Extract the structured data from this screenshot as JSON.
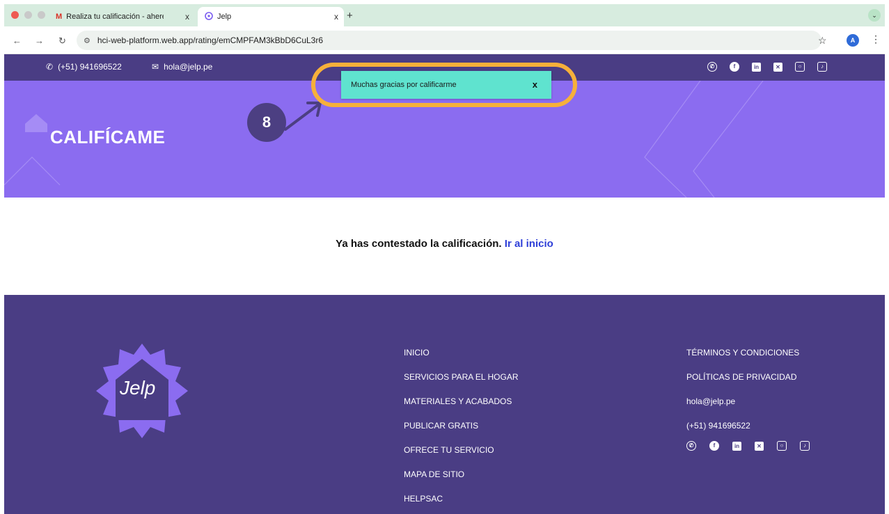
{
  "browser": {
    "tabs": [
      {
        "title": "Realiza tu calificación - ahere",
        "icon": "gmail-icon",
        "close": "x"
      },
      {
        "title": "Jelp",
        "icon": "jelp-favicon-icon",
        "close": "x"
      }
    ],
    "new_tab": "+",
    "menu": "⌄",
    "url": "hci-web-platform.web.app/rating/emCMPFAM3kBbD6CuL3r6",
    "profile_initial": "A"
  },
  "topbar": {
    "phone": "(+51) 941696522",
    "email": "hola@jelp.pe",
    "socials": [
      "whatsapp-icon",
      "facebook-icon",
      "linkedin-icon",
      "x-icon",
      "instagram-icon",
      "tiktok-icon"
    ]
  },
  "hero": {
    "title": "CALIFÍCAME"
  },
  "toast": {
    "message": "Muchas gracias por calificarme",
    "close": "x"
  },
  "annotation": {
    "step": "8",
    "highlight_color": "#f6b03a"
  },
  "main": {
    "message": "Ya has contestado la calificación.",
    "link": "Ir al inicio"
  },
  "footer": {
    "logo_text": "Jelp",
    "col1": [
      "INICIO",
      "SERVICIOS PARA EL HOGAR",
      "MATERIALES Y ACABADOS",
      "PUBLICAR GRATIS",
      "OFRECE TU SERVICIO",
      "MAPA DE SITIO",
      "HELPSAC"
    ],
    "col2": [
      "TÉRMINOS Y CONDICIONES",
      "POLÍTICAS DE PRIVACIDAD",
      "hola@jelp.pe",
      "(+51) 941696522"
    ]
  },
  "colors": {
    "brand_dark": "#4a3d84",
    "brand_light": "#8b6cf0",
    "toast": "#5fe3cf",
    "link": "#2e3fd8"
  }
}
